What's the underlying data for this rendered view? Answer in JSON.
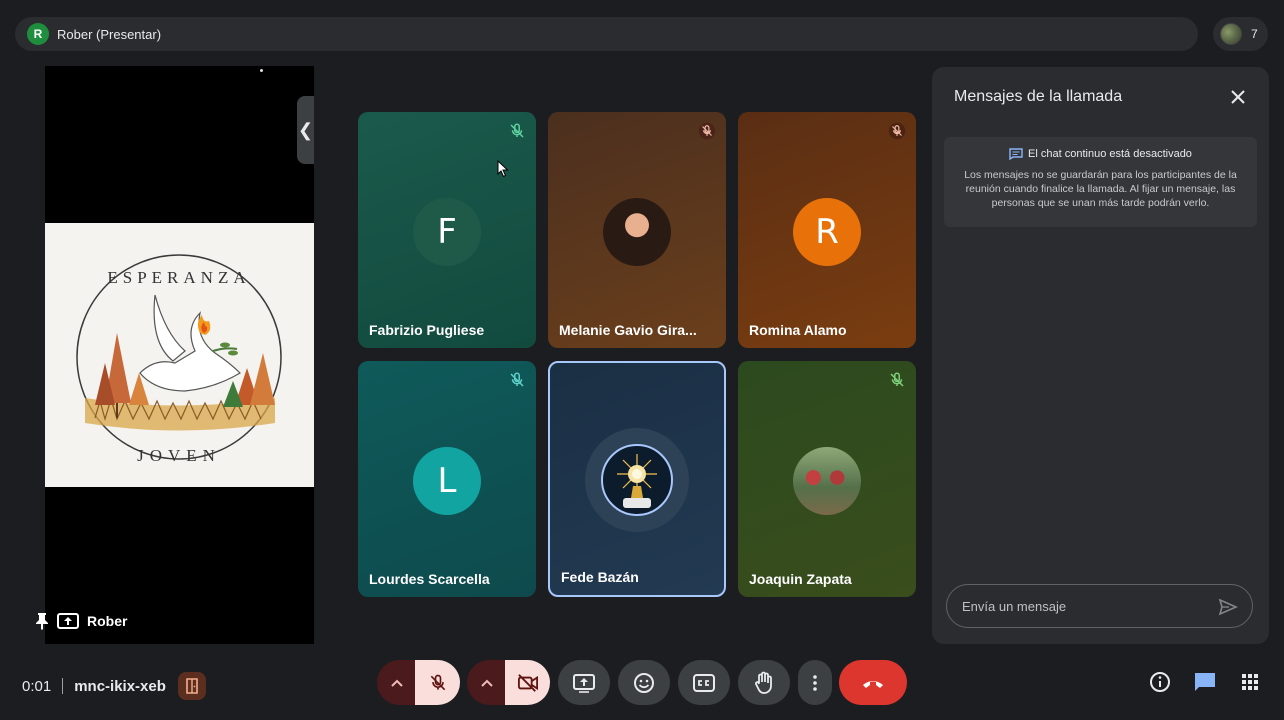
{
  "topbar": {
    "presenter_initial": "R",
    "presenter_label": "Rober (Presentar)",
    "participant_count": "7"
  },
  "presentation": {
    "slide_title_top": "ESPERANZA",
    "slide_title_bottom": "JOVEN",
    "collapse_glyph": "❮",
    "presenter_name": "Rober"
  },
  "tiles": [
    {
      "name": "Fabrizio Pugliese",
      "initial": "F",
      "avatar_color": "#1f5a49",
      "muted": true
    },
    {
      "name": "Melanie Gavio Gira...",
      "initial": "",
      "avatar_color": "#2a1a14",
      "muted": true
    },
    {
      "name": "Romina Alamo",
      "initial": "R",
      "avatar_color": "#e8710a",
      "muted": true
    },
    {
      "name": "Lourdes Scarcella",
      "initial": "L",
      "avatar_color": "#12a4a0",
      "muted": true
    },
    {
      "name": "Fede Bazán",
      "initial": "",
      "avatar_color": "#0d1c2c",
      "muted": false
    },
    {
      "name": "Joaquin Zapata",
      "initial": "",
      "avatar_color": "#55704a",
      "muted": true
    }
  ],
  "chat": {
    "title": "Mensajes de la llamada",
    "notice_head": "El chat continuo está desactivado",
    "notice_body": "Los mensajes no se guardarán para los participantes de la reunión cuando finalice la llamada. Al fijar un mensaje, las personas que se unan más tarde podrán verlo.",
    "input_placeholder": "Envía un mensaje"
  },
  "bottom": {
    "time": "0:01",
    "meeting_code": "mnc-ikix-xeb"
  },
  "colors": {
    "end_call": "#dc362e",
    "muted_button_bg": "#f9dedc",
    "accent_blue": "#a8c7fa"
  }
}
